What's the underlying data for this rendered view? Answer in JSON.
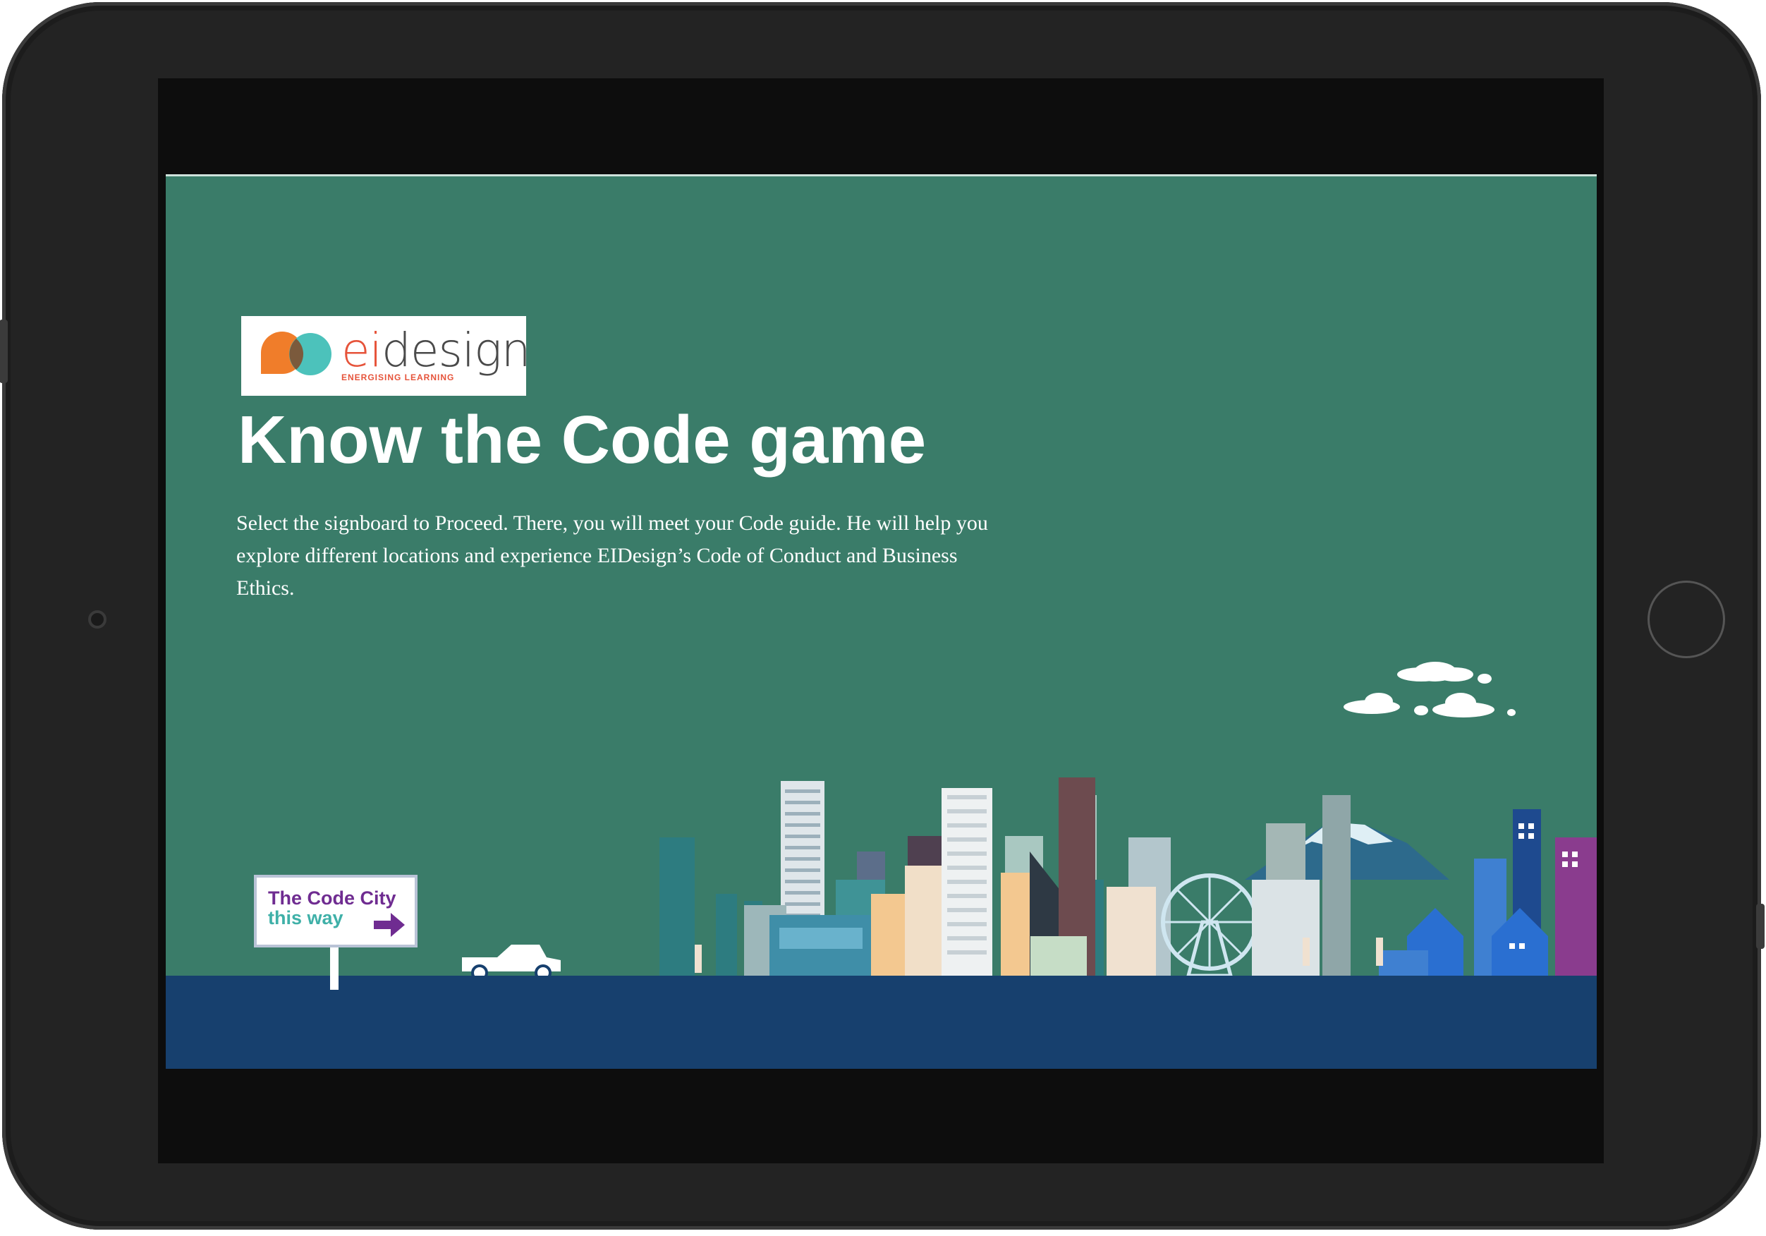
{
  "logo": {
    "prefix": "ei",
    "suffix": "design",
    "tagline": "ENERGISING LEARNING",
    "colors": {
      "orange": "#f07d2a",
      "teal": "#4cc2bb",
      "overlap": "#7b5a3c",
      "red": "#e6533a"
    }
  },
  "title": "Know the Code game",
  "description": "Select the signboard to Proceed.  There, you will meet your Code guide.  He will help you explore different locations and experience EIDesign’s Code of Conduct and Business Ethics.",
  "signboard": {
    "line1": "The Code City",
    "line2": "this way",
    "icon": "arrow-right-icon"
  },
  "colors": {
    "background": "#3a7c69",
    "road": "#17406e",
    "tablet_frame": "#232323"
  }
}
